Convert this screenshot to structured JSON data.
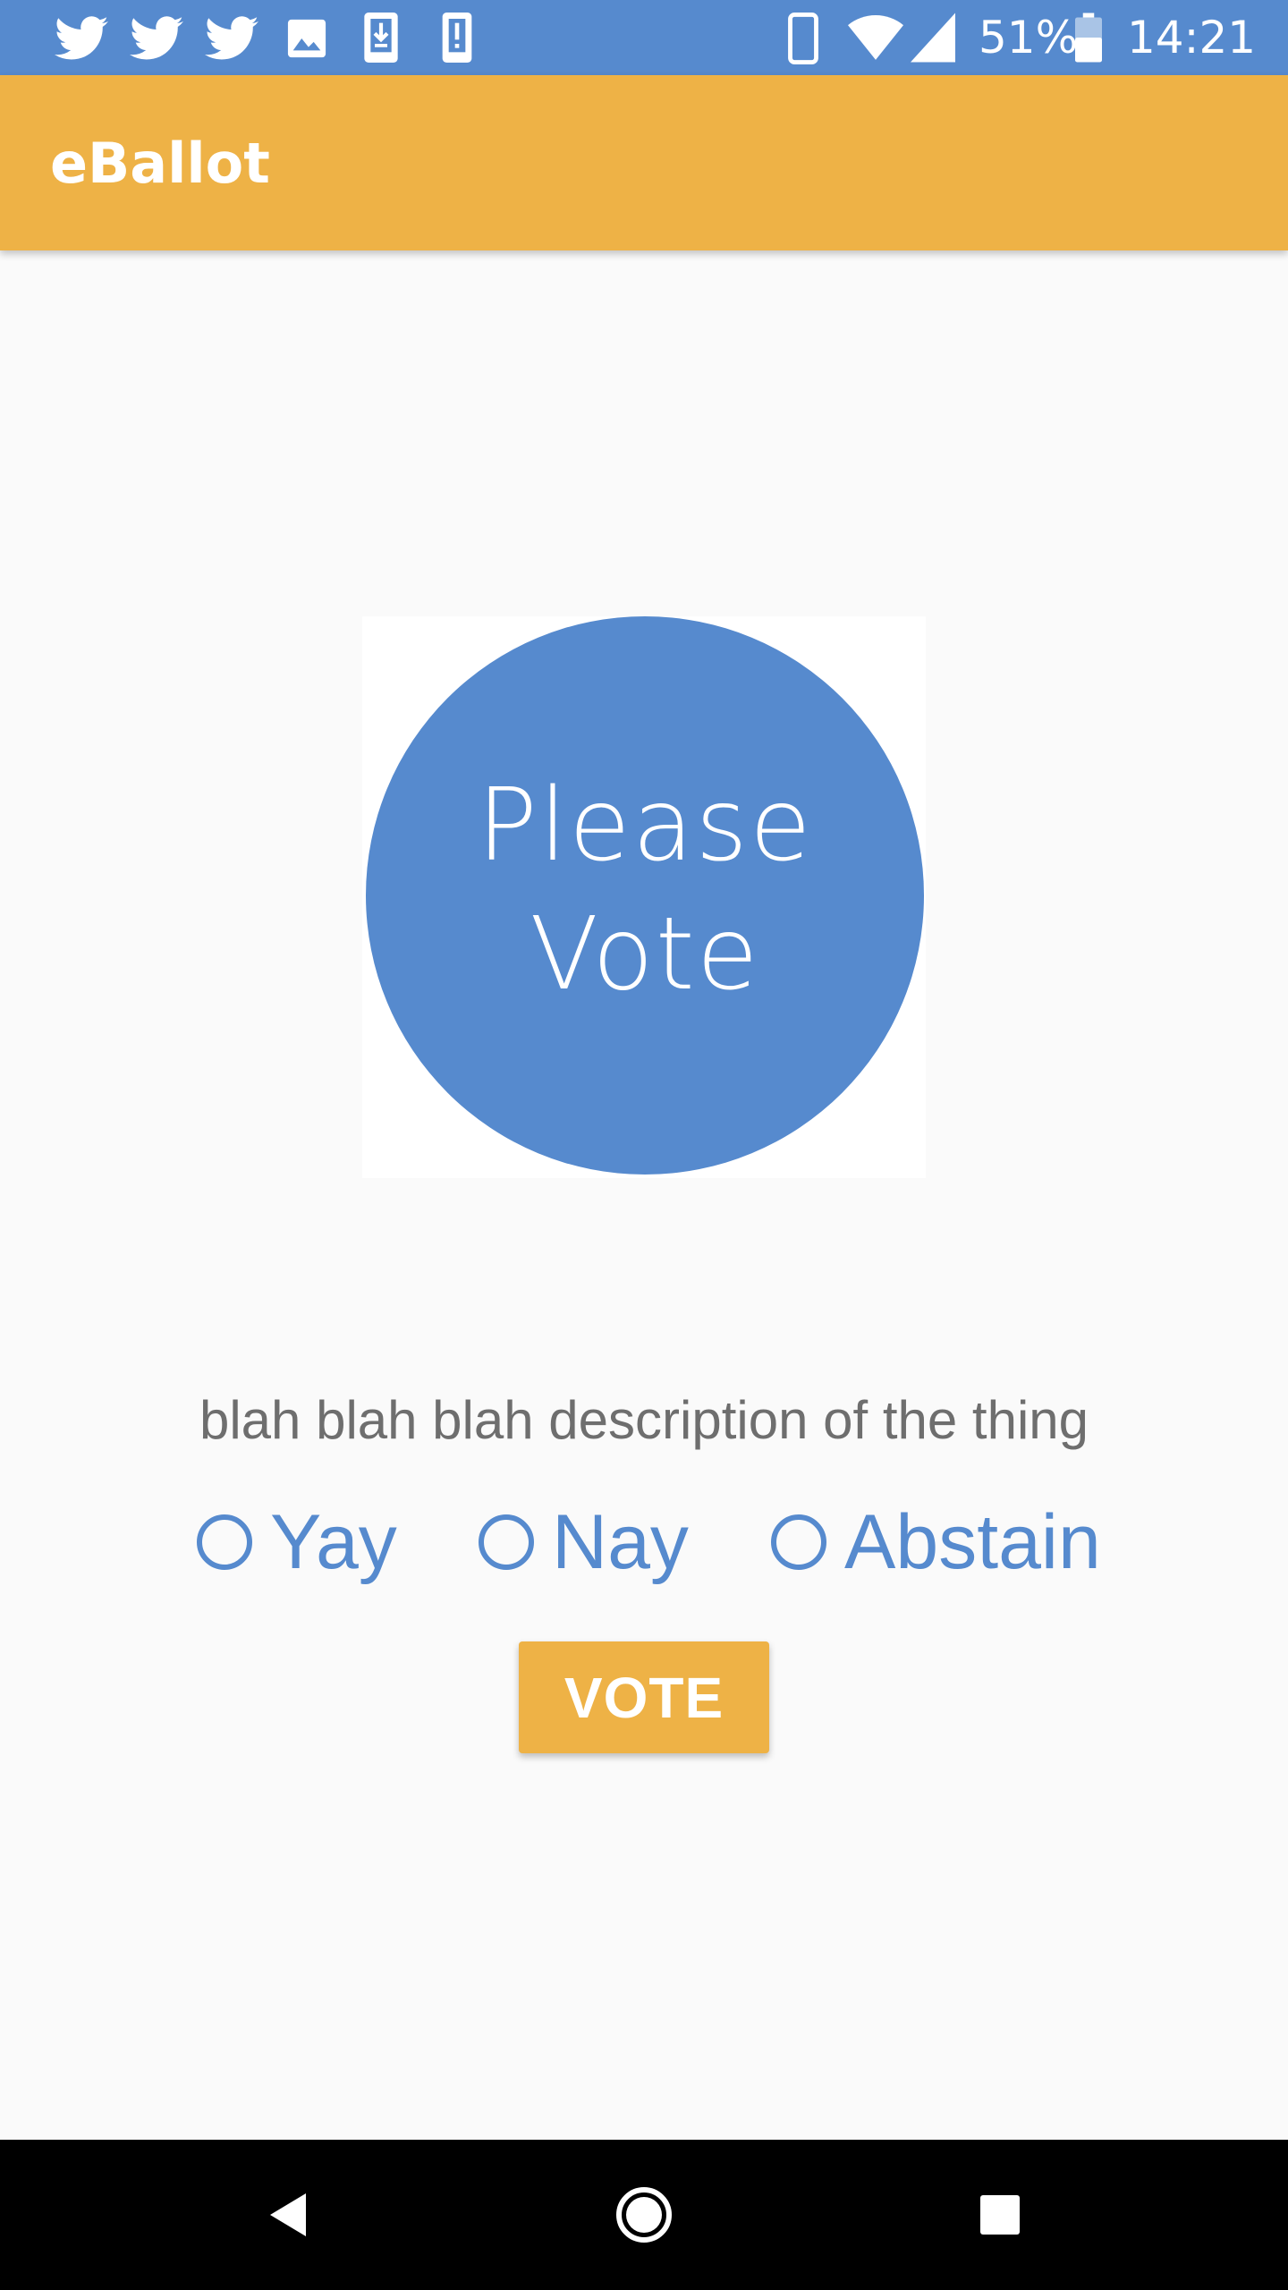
{
  "status_bar": {
    "notification_icons": [
      "twitter-icon",
      "twitter-icon",
      "twitter-icon",
      "image-icon",
      "download-icon",
      "alert-phone-icon"
    ],
    "system_icons": [
      "phone-icon",
      "wifi-icon",
      "signal-icon",
      "battery-icon"
    ],
    "battery": "51%",
    "time": "14:21",
    "background": "#568ace"
  },
  "app_bar": {
    "title": "eBallot",
    "background": "#eeb246"
  },
  "hero": {
    "line1": "Please",
    "line2": "Vote",
    "circle_color": "#568ace"
  },
  "ballot": {
    "description": "blah blah blah description of the thing",
    "options": [
      "Yay",
      "Nay",
      "Abstain"
    ],
    "selected": null,
    "submit_label": "VOTE"
  },
  "nav_bar": {
    "buttons": [
      "back-icon",
      "home-icon",
      "recents-icon"
    ]
  },
  "colors": {
    "accent_blue": "#568ace",
    "accent_orange": "#eeb246",
    "background": "#fafafa"
  }
}
